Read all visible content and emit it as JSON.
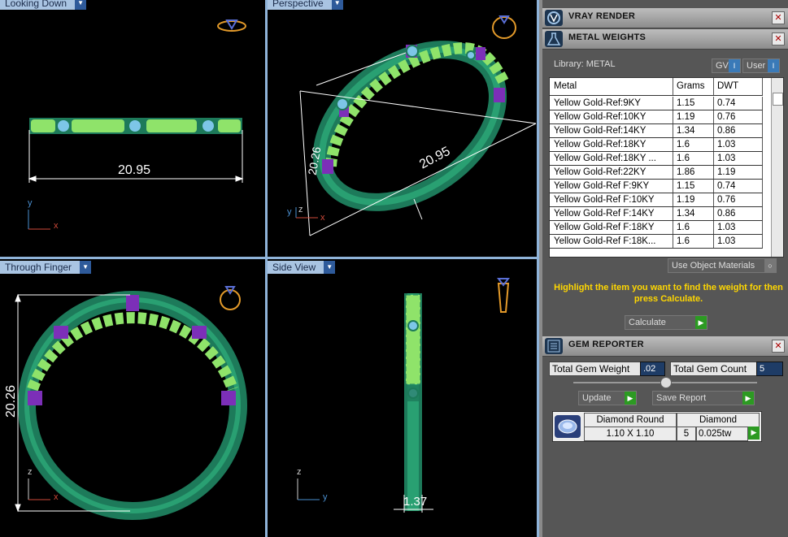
{
  "viewports": {
    "top_left": {
      "label": "Looking Down",
      "dimension": "20.95",
      "axis_v": "y",
      "axis_h": "x"
    },
    "top_right": {
      "label": "Perspective",
      "dimension_a": "20.95",
      "dimension_b": "20.26",
      "axis_v": "z",
      "axis_h": "x",
      "axis_d": "y"
    },
    "bottom_left": {
      "label": "Through Finger",
      "dimension": "20.26",
      "axis_v": "z",
      "axis_h": "x"
    },
    "bottom_right": {
      "label": "Side View",
      "dimension": "1.37",
      "axis_v": "z",
      "axis_h": "y"
    }
  },
  "panel": {
    "vray_title": "VRAY RENDER",
    "metal_title": "METAL WEIGHTS",
    "library_label": "Library: METAL",
    "gv_label": "GV",
    "user_label": "User",
    "columns": [
      "Metal",
      "Grams",
      "DWT"
    ],
    "rows": [
      {
        "metal": "Yellow Gold-Ref:9KY",
        "grams": "1.15",
        "dwt": "0.74"
      },
      {
        "metal": "Yellow Gold-Ref:10KY",
        "grams": "1.19",
        "dwt": "0.76"
      },
      {
        "metal": "Yellow Gold-Ref:14KY",
        "grams": "1.34",
        "dwt": "0.86"
      },
      {
        "metal": "Yellow Gold-Ref:18KY",
        "grams": "1.6",
        "dwt": "1.03"
      },
      {
        "metal": "Yellow Gold-Ref:18KY ...",
        "grams": "1.6",
        "dwt": "1.03"
      },
      {
        "metal": "Yellow Gold-Ref:22KY",
        "grams": "1.86",
        "dwt": "1.19"
      },
      {
        "metal": "Yellow Gold-Ref F:9KY",
        "grams": "1.15",
        "dwt": "0.74"
      },
      {
        "metal": "Yellow Gold-Ref F:10KY",
        "grams": "1.19",
        "dwt": "0.76"
      },
      {
        "metal": "Yellow Gold-Ref F:14KY",
        "grams": "1.34",
        "dwt": "0.86"
      },
      {
        "metal": "Yellow Gold-Ref F:18KY",
        "grams": "1.6",
        "dwt": "1.03"
      },
      {
        "metal": "Yellow Gold-Ref F:18K...",
        "grams": "1.6",
        "dwt": "1.03"
      }
    ],
    "use_object_materials": "Use Object Materials",
    "hint": "Highlight the item you want to find the weight for then press Calculate.",
    "calculate_label": "Calculate",
    "gem_title": "GEM REPORTER",
    "total_gem_weight_label": "Total Gem Weight",
    "total_gem_weight": ".02",
    "total_gem_count_label": "Total Gem Count",
    "total_gem_count": "5",
    "update_label": "Update",
    "save_report_label": "Save Report",
    "gem_shape": "Diamond Round",
    "gem_size": "1.10 X 1.10",
    "gem_type": "Diamond",
    "gem_qty": "5",
    "gem_weight": "0.025tw",
    "accent_color": "#ffd700",
    "go_color": "#2c9a22"
  }
}
